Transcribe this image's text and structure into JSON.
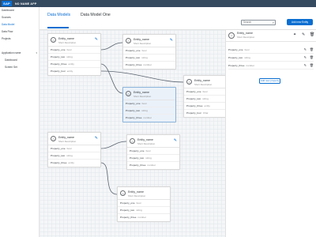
{
  "app": {
    "logo": "SAP",
    "title": "NO NAME APP"
  },
  "nav": {
    "items": [
      {
        "label": "Dashboard",
        "active": false,
        "sub": false
      },
      {
        "label": "Sources",
        "active": false,
        "sub": false
      },
      {
        "label": "Data Model",
        "active": true,
        "sub": false
      },
      {
        "label": "Data Flow",
        "active": false,
        "sub": false
      },
      {
        "label": "Projects",
        "active": false,
        "sub": false
      },
      {
        "label": "Application name",
        "active": false,
        "sub": false
      },
      {
        "label": "Dashboard",
        "active": false,
        "sub": true
      },
      {
        "label": "Screen Set",
        "active": false,
        "sub": true
      }
    ]
  },
  "header": {
    "breadcrumb_root": "Data Models",
    "breadcrumb_current": "Data Model One",
    "search_placeholder": "Search",
    "add_button": "Add new Entity"
  },
  "entities": [
    {
      "name": "Entity_name",
      "desc": "Short Description",
      "props": [
        {
          "name": "Property_one",
          "type": "bool"
        },
        {
          "name": "Property_two",
          "type": "string"
        },
        {
          "name": "Property_three",
          "type": "entity"
        },
        {
          "name": "Property_four",
          "type": "entity"
        }
      ]
    },
    {
      "name": "Entity_name",
      "desc": "Short Description",
      "props": [
        {
          "name": "Property_one",
          "type": "bool"
        },
        {
          "name": "Property_two",
          "type": "string"
        },
        {
          "name": "Property_three",
          "type": "number"
        }
      ]
    },
    {
      "name": "Entity_name",
      "desc": "Short Description",
      "props": [
        {
          "name": "Property_one",
          "type": "bool"
        },
        {
          "name": "Property_two",
          "type": "string"
        },
        {
          "name": "Property_three",
          "type": "number"
        }
      ]
    },
    {
      "name": "Entity_name",
      "desc": "Short Description",
      "props": [
        {
          "name": "Property_one",
          "type": "bool"
        },
        {
          "name": "Property_two",
          "type": "string"
        },
        {
          "name": "Property_three",
          "type": "entity"
        },
        {
          "name": "Property_four",
          "type": "Char"
        }
      ]
    },
    {
      "name": "Entity_name",
      "desc": "Short Description",
      "props": [
        {
          "name": "Property_one",
          "type": "bool"
        },
        {
          "name": "Property_two",
          "type": "string"
        },
        {
          "name": "Property_three",
          "type": "entity"
        }
      ]
    },
    {
      "name": "Entity_name",
      "desc": "Short Description",
      "props": [
        {
          "name": "Property_one",
          "type": "bool"
        },
        {
          "name": "Property_two",
          "type": "string"
        },
        {
          "name": "Property_three",
          "type": "number"
        }
      ]
    },
    {
      "name": "Entity_name",
      "desc": "Short Description",
      "props": [
        {
          "name": "Property_one",
          "type": "bool"
        },
        {
          "name": "Property_two",
          "type": "string"
        },
        {
          "name": "Property_three",
          "type": "number"
        }
      ]
    }
  ],
  "panel": {
    "name": "Entity_name",
    "desc": "Short Description",
    "props": [
      {
        "name": "Property_one",
        "type": "bool"
      },
      {
        "name": "Property_two",
        "type": "string"
      },
      {
        "name": "Property_three",
        "type": "number"
      }
    ],
    "add_property": "Add new property"
  },
  "colors": {
    "shell": "#354a5f",
    "accent": "#0a6ed1",
    "selected": "#eaf1f9",
    "canvas": "#f4f6f8"
  }
}
